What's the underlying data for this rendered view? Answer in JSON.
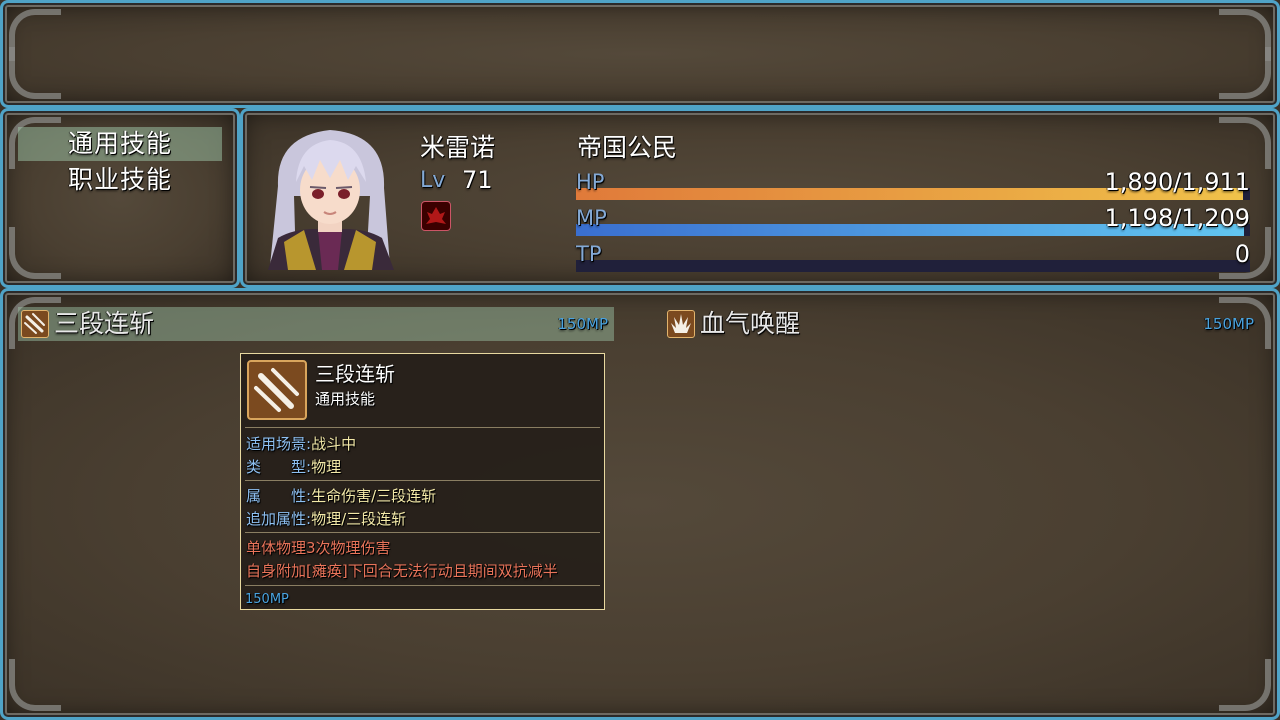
{
  "categories": [
    {
      "label": "通用技能",
      "selected": true
    },
    {
      "label": "职业技能",
      "selected": false
    }
  ],
  "actor": {
    "name": "米雷诺",
    "level_label": "Lv",
    "level": "71",
    "class_name": "帝国公民",
    "hp": {
      "label": "HP",
      "text": "1,890/1,911",
      "current": 1890,
      "max": 1911
    },
    "mp": {
      "label": "MP",
      "text": "1,198/1,209",
      "current": 1198,
      "max": 1209
    },
    "tp": {
      "label": "TP",
      "text": "0",
      "current": 0,
      "max": 100
    }
  },
  "skills": [
    {
      "name": "三段连斩",
      "cost": "150MP",
      "icon": "triple-slash-icon",
      "selected": true
    },
    {
      "name": "血气唤醒",
      "cost": "150MP",
      "icon": "blood-awaken-icon",
      "selected": false
    }
  ],
  "tooltip": {
    "title": "三段连斩",
    "subtitle": "通用技能",
    "rows": [
      {
        "key": "适用场景",
        "sep": ":",
        "value": "战斗中"
      },
      {
        "key": "类　　型",
        "sep": ":",
        "value": "物理"
      },
      {
        "key": "属　　性",
        "sep": ":",
        "value": "生命伤害/三段连斩"
      },
      {
        "key": "追加属性",
        "sep": ":",
        "value": "物理/三段连斩"
      }
    ],
    "desc1": "单体物理3次物理伤害",
    "desc2": "自身附加[瘫痪]下回合无法行动且期间双抗减半",
    "cost": "150MP"
  },
  "colors": {
    "border": "#4fa3c7",
    "hp_gauge": [
      "#e07a3a",
      "#f0c24a"
    ],
    "mp_gauge": [
      "#3a6fd0",
      "#62c6f0"
    ],
    "label_blue": "#84aad6",
    "cost_blue": "#4aa3df"
  }
}
